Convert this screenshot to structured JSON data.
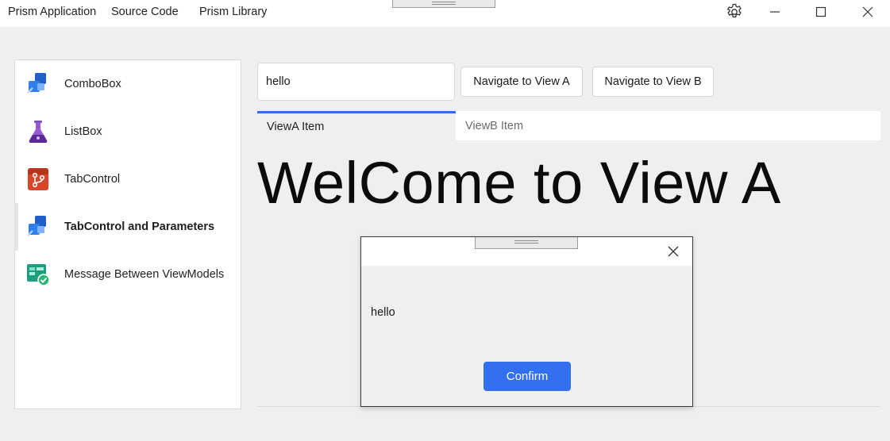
{
  "titlebar": {
    "app_title": "Prism Application",
    "menu": [
      "Source Code",
      "Prism Library"
    ]
  },
  "sidebar": {
    "items": [
      {
        "label": "ComboBox",
        "icon": "blue-puzzle-icon"
      },
      {
        "label": "ListBox",
        "icon": "purple-flask-icon"
      },
      {
        "label": "TabControl",
        "icon": "orange-git-icon"
      },
      {
        "label": "TabControl and Parameters",
        "icon": "blue-puzzle-icon",
        "active": true
      },
      {
        "label": "Message Between ViewModels",
        "icon": "green-board-check-icon"
      }
    ]
  },
  "main": {
    "input_value": "hello",
    "nav_a_label": "Navigate to View A",
    "nav_b_label": "Navigate to View B",
    "tabs": [
      {
        "label": "ViewA Item",
        "selected": true
      },
      {
        "label": "ViewB Item",
        "selected": false
      }
    ],
    "headline": "WelCome to View A"
  },
  "dialog": {
    "message": "hello",
    "confirm_label": "Confirm"
  },
  "colors": {
    "accent": "#3370f0",
    "tab_indicator": "#2f6fe4",
    "background": "#efefef"
  }
}
